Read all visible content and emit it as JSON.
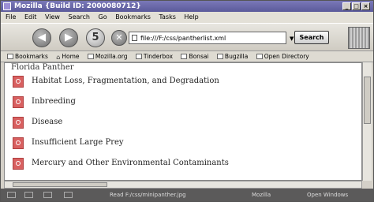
{
  "window": {
    "title": "Mozilla {Build ID: 2000080712}"
  },
  "menu": [
    "File",
    "Edit",
    "View",
    "Search",
    "Go",
    "Bookmarks",
    "Tasks",
    "Help"
  ],
  "nav": {
    "back": "◀",
    "forward": "▶",
    "reload": "5",
    "stop": "✕",
    "url": "file:///F:/css/pantherlist.xml",
    "search_label": "Search"
  },
  "bookmarks": [
    "Bookmarks",
    "Home",
    "Mozilla.org",
    "Tinderbox",
    "Bonsai",
    "Bugzilla",
    "Open Directory"
  ],
  "content": {
    "heading": "Florida Panther",
    "items": [
      "Habitat Loss, Fragmentation, and Degradation",
      "Inbreeding",
      "Disease",
      "Insufficient Large Prey",
      "Mercury and Other Environmental Contaminants"
    ]
  },
  "status": {
    "text": "Read F:/css/minipanther.jpg",
    "mozilla": "Mozilla",
    "open_windows": "Open Windows"
  }
}
